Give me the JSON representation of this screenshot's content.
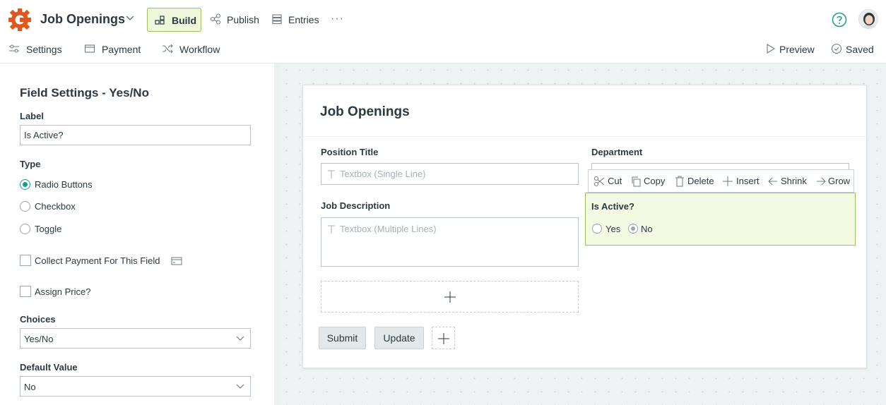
{
  "header": {
    "app_title": "Job Openings",
    "nav": {
      "build": "Build",
      "publish": "Publish",
      "entries": "Entries",
      "more": "···"
    },
    "accent": "#9cc35a",
    "brand": "#e0561c"
  },
  "subnav": {
    "settings": "Settings",
    "payment": "Payment",
    "workflow": "Workflow",
    "preview": "Preview",
    "saved": "Saved"
  },
  "panel": {
    "title": "Field Settings - Yes/No",
    "label_heading": "Label",
    "label_value": "Is Active?",
    "type_heading": "Type",
    "types": [
      "Radio Buttons",
      "Checkbox",
      "Toggle"
    ],
    "selected_type": "Radio Buttons",
    "collect_payment": "Collect Payment For This Field",
    "assign_price": "Assign Price?",
    "choices_heading": "Choices",
    "choices_value": "Yes/No",
    "default_heading": "Default Value",
    "default_value": "No"
  },
  "form": {
    "title": "Job Openings",
    "position_title_label": "Position Title",
    "position_title_placeholder": "Textbox (Single Line)",
    "department_label": "Department",
    "job_description_label": "Job Description",
    "job_description_placeholder": "Textbox (Multiple Lines)",
    "is_active_label": "Is Active?",
    "is_active_options": [
      "Yes",
      "No"
    ],
    "is_active_selected": "No",
    "submit": "Submit",
    "update": "Update"
  },
  "field_toolbar": {
    "cut": "Cut",
    "copy": "Copy",
    "delete": "Delete",
    "insert": "Insert",
    "shrink": "Shrink",
    "grow": "Grow"
  }
}
